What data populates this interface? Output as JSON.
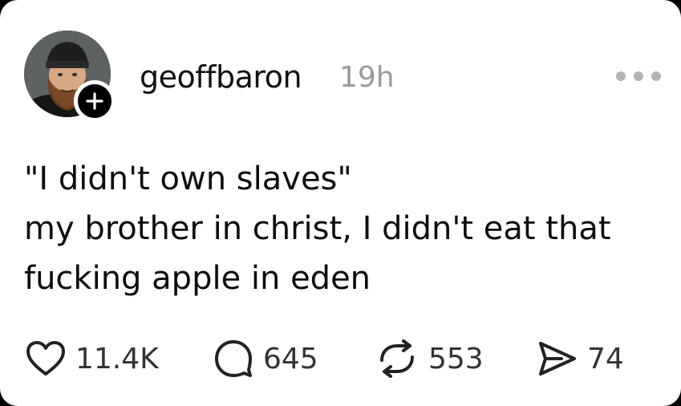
{
  "post": {
    "username": "geoffbaron",
    "time": "19h",
    "lines": [
      "\"I didn't own slaves\"",
      "my brother in christ, I didn't eat that",
      "fucking apple in eden"
    ]
  },
  "actions": {
    "likes": "11.4K",
    "replies": "645",
    "reposts": "553",
    "shares": "74"
  },
  "icons": {
    "follow": "plus-icon",
    "more": "more-dots-icon",
    "like": "heart-icon",
    "reply": "speech-bubble-icon",
    "repost": "repost-arrows-icon",
    "share": "send-icon"
  }
}
